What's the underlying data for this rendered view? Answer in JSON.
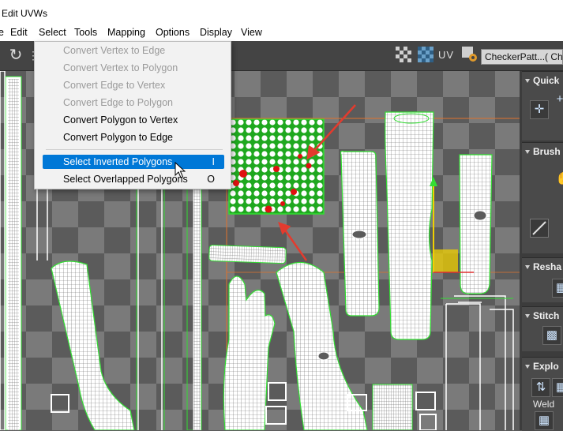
{
  "window": {
    "title": "Edit UVWs"
  },
  "menubar": {
    "items": [
      "e",
      "Edit",
      "Select",
      "Tools",
      "Mapping",
      "Options",
      "Display",
      "View"
    ]
  },
  "toolbar": {
    "uv_label": "UV",
    "texture_select": "CheckerPatt...( Checke"
  },
  "select_menu": {
    "items": [
      {
        "label": "Convert Vertex to Edge",
        "enabled": false,
        "shortcut": ""
      },
      {
        "label": "Convert Vertex to Polygon",
        "enabled": false,
        "shortcut": ""
      },
      {
        "label": "Convert Edge to Vertex",
        "enabled": false,
        "shortcut": ""
      },
      {
        "label": "Convert Edge to Polygon",
        "enabled": false,
        "shortcut": ""
      },
      {
        "label": "Convert Polygon to Vertex",
        "enabled": true,
        "shortcut": ""
      },
      {
        "label": "Convert Polygon to Edge",
        "enabled": true,
        "shortcut": ""
      },
      {
        "label": "Select Inverted Polygons",
        "enabled": true,
        "highlighted": true,
        "shortcut": "I"
      },
      {
        "label": "Select Overlapped Polygons",
        "enabled": true,
        "shortcut": "O"
      }
    ]
  },
  "side_panel": {
    "panels": [
      {
        "title": "Quick"
      },
      {
        "title": "Brush"
      },
      {
        "title": "Resha"
      },
      {
        "title": "Stitch"
      },
      {
        "title": "Explo",
        "weld_label": "Weld"
      }
    ]
  },
  "colors": {
    "accent": "#0078d7",
    "uv_edge": "#33dd33",
    "annotation_arrow": "#e33b2e",
    "selection_gizmo": "#f0d000"
  }
}
